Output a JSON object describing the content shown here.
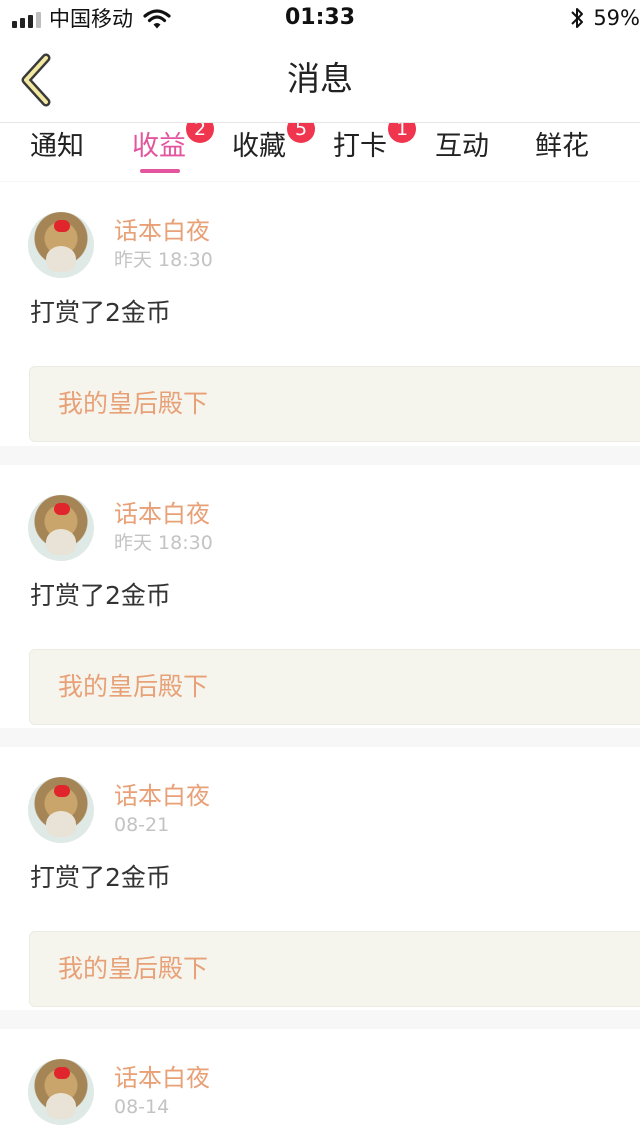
{
  "status_bar": {
    "carrier": "中国移动",
    "time": "01:33",
    "battery": "59%"
  },
  "nav": {
    "title": "消息",
    "back_icon": "chevron-left-icon"
  },
  "tabs": [
    {
      "label": "通知",
      "badge": ""
    },
    {
      "label": "收益",
      "badge": "2",
      "active": true
    },
    {
      "label": "收藏",
      "badge": "5"
    },
    {
      "label": "打卡",
      "badge": "1"
    },
    {
      "label": "互动",
      "badge": ""
    },
    {
      "label": "鲜花",
      "badge": ""
    }
  ],
  "colors": {
    "accent": "#e3559f",
    "badge": "#f0364f",
    "username": "#e8a077",
    "ref_bg": "#f5f5ee"
  },
  "messages": [
    {
      "user": "话本白夜",
      "time": "昨天 18:30",
      "text": "打赏了2金币",
      "ref": "我的皇后殿下"
    },
    {
      "user": "话本白夜",
      "time": "昨天 18:30",
      "text": "打赏了2金币",
      "ref": "我的皇后殿下"
    },
    {
      "user": "话本白夜",
      "time": "08-21",
      "text": "打赏了2金币",
      "ref": "我的皇后殿下"
    },
    {
      "user": "话本白夜",
      "time": "08-14"
    }
  ]
}
